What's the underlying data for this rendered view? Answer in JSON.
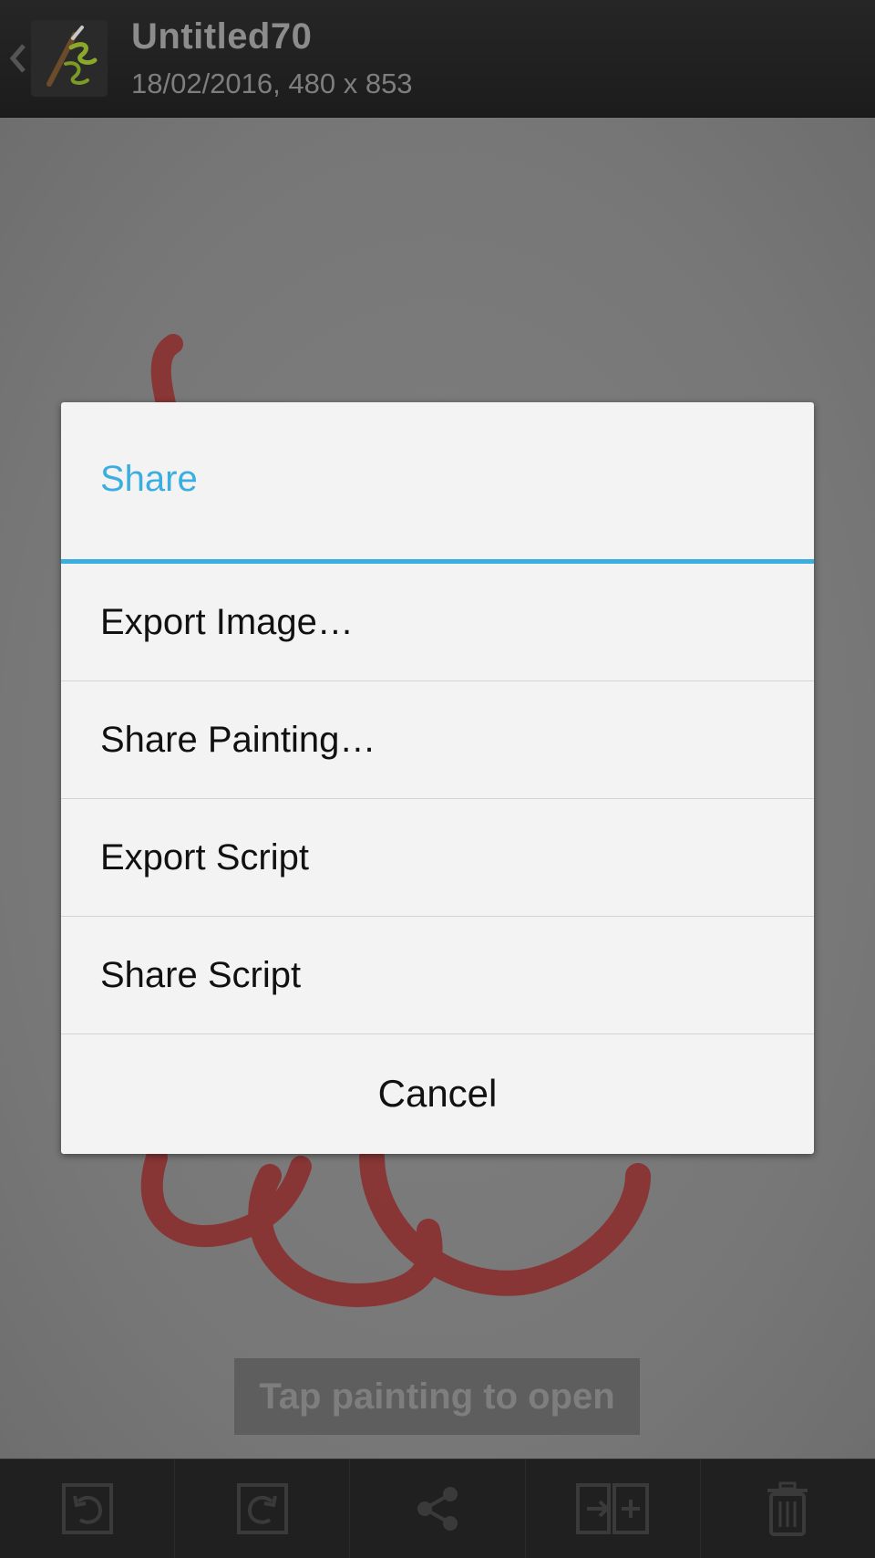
{
  "header": {
    "title": "Untitled70",
    "subtitle": "18/02/2016, 480 x 853"
  },
  "canvas": {
    "hint": "Tap painting to open"
  },
  "dialog": {
    "title": "Share",
    "items": [
      {
        "label": "Export Image…"
      },
      {
        "label": "Share Painting…"
      },
      {
        "label": "Export Script"
      },
      {
        "label": "Share Script"
      }
    ],
    "cancel_label": "Cancel"
  },
  "toolbar": {
    "buttons": [
      "undo-icon",
      "redo-icon",
      "share-icon",
      "import-icon",
      "trash-icon"
    ]
  },
  "colors": {
    "accent": "#3aaee0",
    "stroke": "#8b2a2a"
  }
}
